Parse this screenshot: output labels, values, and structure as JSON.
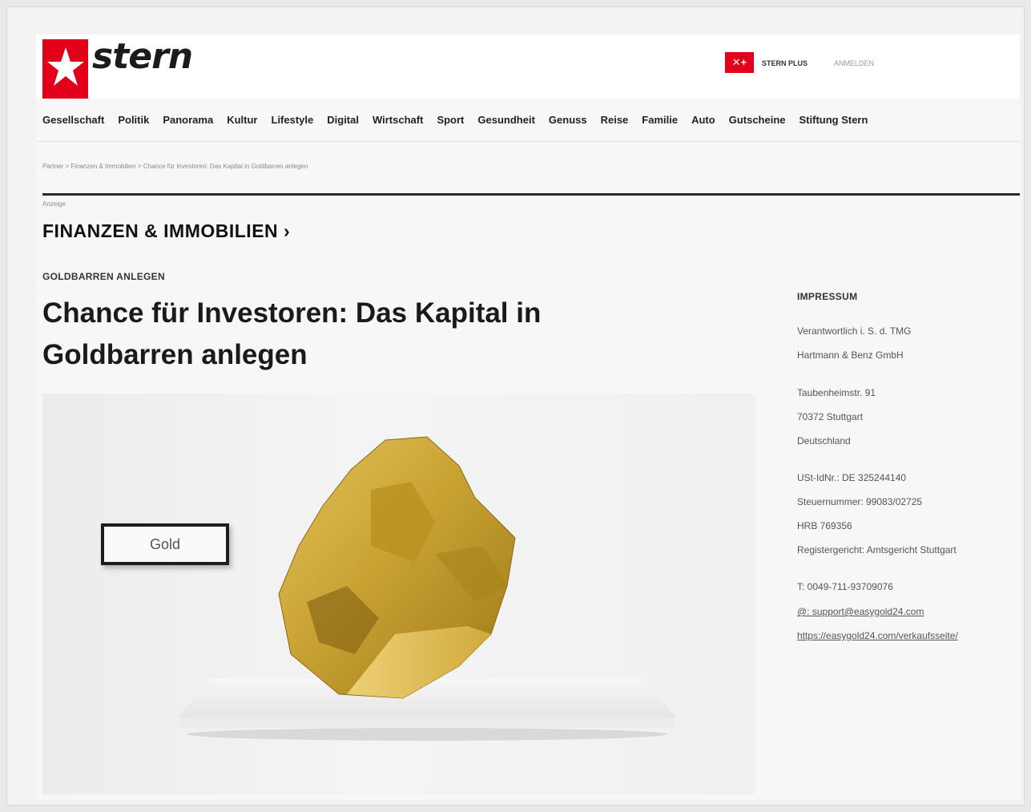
{
  "header": {
    "logo_text": "stern",
    "plus_icon_text": "✕+",
    "plus_label": "STERN PLUS",
    "login_label": "ANMELDEN"
  },
  "nav": {
    "items": [
      "Gesellschaft",
      "Politik",
      "Panorama",
      "Kultur",
      "Lifestyle",
      "Digital",
      "Wirtschaft",
      "Sport",
      "Gesundheit",
      "Genuss",
      "Reise",
      "Familie",
      "Auto",
      "Gutscheine",
      "Stiftung Stern"
    ]
  },
  "breadcrumb": "Partner > Finanzen & Immobilien > Chance für Investoren: Das Kapital in Goldbarren anlegen",
  "article": {
    "ad_label": "Anzeige",
    "section_title": "FINANZEN & IMMOBILIEN ›",
    "kicker": "GOLDBARREN ANLEGEN",
    "headline_line1": "Chance für Investoren: Das Kapital in",
    "headline_line2": "Goldbarren anlegen",
    "image_sign": "Gold"
  },
  "impressum": {
    "title": "IMPRESSUM",
    "responsible": "Verantwortlich i. S. d. TMG",
    "company": "Hartmann & Benz GmbH",
    "street": "Taubenheimstr. 91",
    "city": "70372 Stuttgart",
    "country": "Deutschland",
    "vat": "USt-IdNr.: DE 325244140",
    "tax": "Steuernummer: 99083/02725",
    "hrb": "HRB 769356",
    "court": "Registergericht: Amtsgericht Stuttgart",
    "phone": "T: 0049-711-93709076",
    "email": "@: support@easygold24.com",
    "url": "https://easygold24.com/verkaufsseite/"
  },
  "colors": {
    "brand_red": "#e2001a",
    "gold": "#c9a233"
  }
}
